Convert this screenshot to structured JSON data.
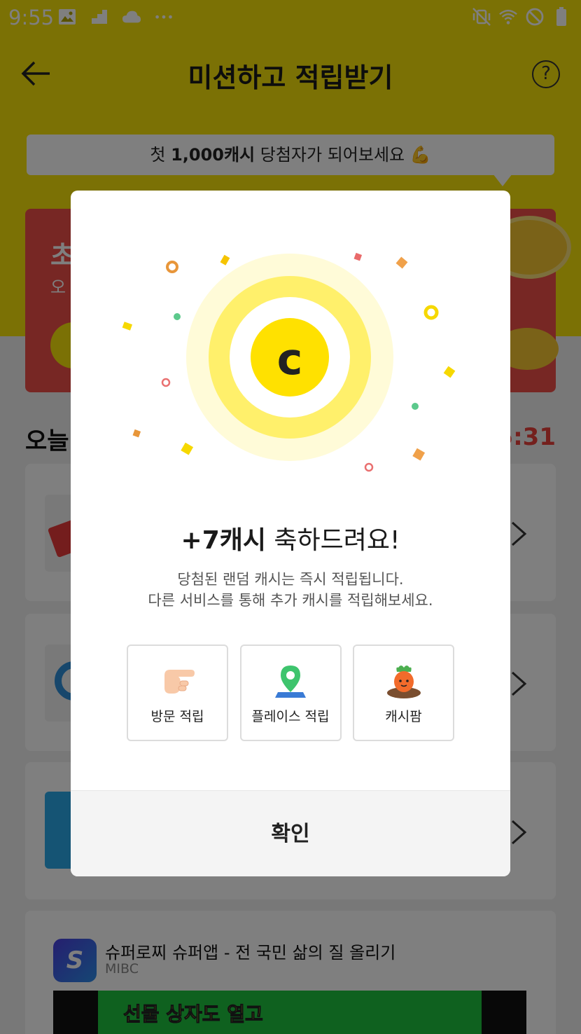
{
  "status_bar": {
    "time": "9:55",
    "icons_left": [
      "image-icon",
      "signal-steps-icon",
      "cloud-icon",
      "more-dots-icon"
    ],
    "icons_right": [
      "vibrate-mute-icon",
      "wifi-icon",
      "do-not-disturb-icon",
      "battery-icon"
    ],
    "dots": "•••"
  },
  "header": {
    "title": "미션하고 적립받기",
    "back_icon": "arrow-left-icon",
    "help_label": "?"
  },
  "promo": {
    "prefix": "첫 ",
    "amount": "1,000캐시",
    "suffix": " 당첨자가 되어보세요 💪"
  },
  "red_card": {
    "title": "초",
    "subtitle": "오"
  },
  "section": {
    "title": "오늘",
    "timer": "5:31"
  },
  "app_promo": {
    "icon_letter": "S",
    "name": "슈퍼로찌 슈퍼앱 - 전 국민 삶의 질 올리기",
    "developer": "MIBC",
    "banner_text": "선물 상자도 열고"
  },
  "dialog": {
    "title_bold": "+7캐시",
    "title_rest": " 축하드려요!",
    "desc_line1": "당첨된 랜덤 캐시는 즉시 적립됩니다.",
    "desc_line2": "다른 서비스를 통해 추가 캐시를 적립해보세요.",
    "coin_letter": "c",
    "options": [
      {
        "label": "방문 적립",
        "icon": "pointing-hand-icon"
      },
      {
        "label": "플레이스 적립",
        "icon": "map-pin-icon"
      },
      {
        "label": "캐시팜",
        "icon": "carrot-icon"
      }
    ],
    "confirm_label": "확인"
  },
  "colors": {
    "brand_yellow": "#f6e20a",
    "coin_yellow": "#ffe100",
    "alert_red": "#ef4f48",
    "confirm_bg": "#f4f4f4"
  }
}
